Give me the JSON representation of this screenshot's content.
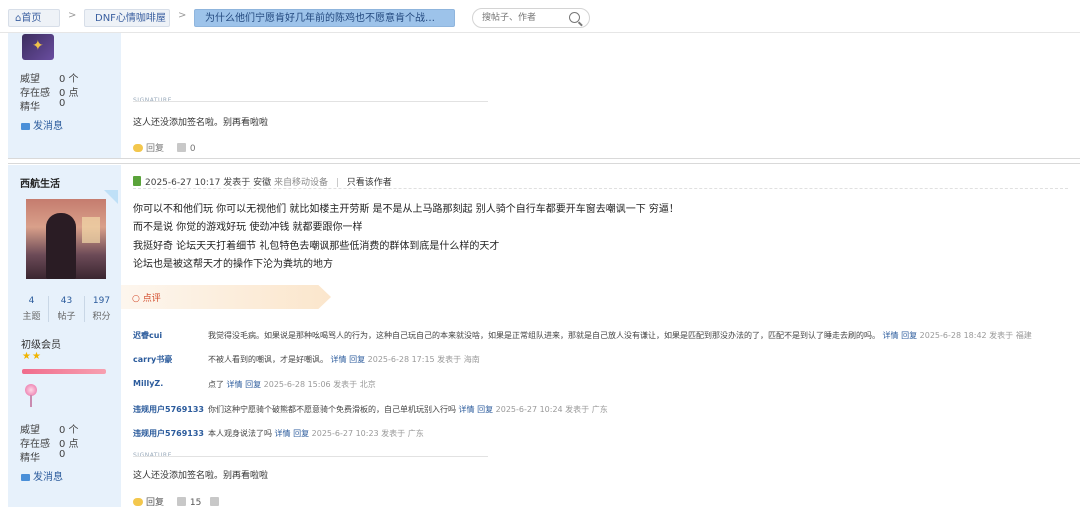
{
  "breadcrumb": {
    "home": "首页",
    "forum": "DNF心情咖啡屋",
    "thread": "为什么他们宁愿肯好几年前的陈鸡也不愿意肯个战令宠物 ..."
  },
  "search": {
    "placeholder": "搜帖子、作者"
  },
  "post1": {
    "stats": [
      {
        "label": "威望",
        "value": "0 个"
      },
      {
        "label": "存在感",
        "value": "0 点"
      },
      {
        "label": "精华",
        "value": "0"
      }
    ],
    "send_message": "发消息",
    "signature_label": "SIGNATURE",
    "signature": "这人还没添加签名啦。别再看啦啦",
    "reply_label": "回复",
    "like_count": "0"
  },
  "post2": {
    "username": "西航生活",
    "profile_stats": [
      {
        "num": "4",
        "label": "主题"
      },
      {
        "num": "43",
        "label": "帖子"
      },
      {
        "num": "197",
        "label": "积分"
      }
    ],
    "rank": "初级会员",
    "stars": "★★",
    "stats": [
      {
        "label": "威望",
        "value": "0 个"
      },
      {
        "label": "存在感",
        "value": "0 点"
      },
      {
        "label": "精华",
        "value": "0"
      }
    ],
    "send_message": "发消息",
    "header": {
      "date": "2025-6-27 10:17 发表于 安徽",
      "from": "来自移动设备",
      "only_author": "只看该作者"
    },
    "body_lines": [
      "你可以不和他们玩  你可以无视他们  就比如楼主开劳斯 是不是从上马路那刻起 别人骑个自行车都要开车窗去嘲讽一下  穷逼！",
      "   而不是说 你觉的游戏好玩 使劲冲钱 就都要跟你一样",
      "我挺好奇 论坛天天打着细节 礼包特色去嘲讽那些低消费的群体到底是什么样的天才",
      "          论坛也是被这帮天才的操作下沦为粪坑的地方"
    ],
    "comment_tab": "点评",
    "comments": [
      {
        "user": "迟睿cui",
        "text": "我觉得没毛病。如果说是那种吆喝骂人的行为，这种自己玩自己的本来就没啥，如果是正常组队进来，那就是自己放人没有谦让，如果是匹配到那没办法的了，匹配不是到认了睡走去刷的吗。",
        "links": "详情 回复",
        "meta": "2025-6-28 18:42 发表于 福建"
      },
      {
        "user": "carry书豪",
        "text": "不被人看到的嘲讽，才是好嘲讽。",
        "links": "详情 回复",
        "meta": "2025-6-28 17:15 发表于 海南"
      },
      {
        "user": "MillyZ.",
        "text": "点了",
        "links": "详情 回复",
        "meta": "2025-6-28 15:06 发表于 北京"
      },
      {
        "user": "违规用户5769133",
        "text": "你们这种宁愿骑个破熊都不愿意骑个免费滑板的，自己单机玩别入行吗",
        "links": "详情 回复",
        "meta": "2025-6-27 10:24 发表于 广东"
      },
      {
        "user": "违规用户5769133",
        "text": "本人观身说法了吗",
        "links": "详情 回复",
        "meta": "2025-6-27 10:23 发表于 广东"
      }
    ],
    "signature_label": "SIGNATURE",
    "signature": "这人还没添加签名啦。别再看啦啦",
    "reply_label": "回复",
    "like_count": "15"
  },
  "colors": {
    "accent": "#2b5b9c",
    "sidebar_bg": "#e7f1fb",
    "crumb_active": "#9dc3ea",
    "comment_red": "#d24a2a"
  }
}
